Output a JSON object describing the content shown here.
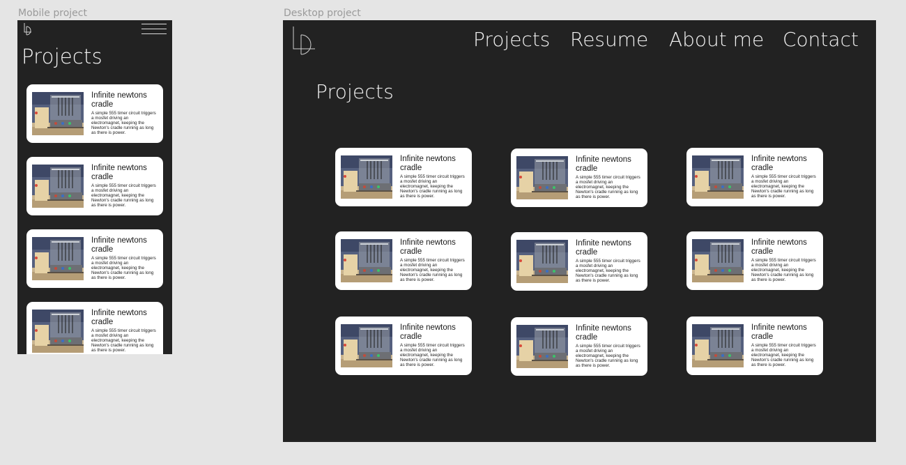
{
  "frames": {
    "mobile_label": "Mobile project",
    "desktop_label": "Desktop project"
  },
  "mobile": {
    "logo_icon": "ld-monogram-icon",
    "menu_icon": "hamburger-menu-icon",
    "page_title": "Projects",
    "cards": [
      {
        "title": "Infinite newtons cradle",
        "description": "A simple 555 timer circuit triggers a mosfet driving an electromagnet, keeping the Newton's cradle running as long as there is power."
      },
      {
        "title": "Infinite newtons cradle",
        "description": "A simple 555 timer circuit triggers a mosfet driving an electromagnet, keeping the Newton's cradle running as long as there is power."
      },
      {
        "title": "Infinite newtons cradle",
        "description": "A simple 555 timer circuit triggers a mosfet driving an electromagnet, keeping the Newton's cradle running as long as there is power."
      },
      {
        "title": "Infinite newtons cradle",
        "description": "A simple 555 timer circuit triggers a mosfet driving an electromagnet, keeping the Newton's cradle running as long as there is power."
      }
    ]
  },
  "desktop": {
    "logo_icon": "ld-monogram-icon",
    "nav": [
      "Projects",
      "Resume",
      "About me",
      "Contact"
    ],
    "page_title": "Projects",
    "cards": [
      {
        "title": "Infinite newtons cradle",
        "description": "A simple 555 timer circuit triggers a mosfet driving an electromagnet, keeping the Newton's cradle running as long as there is power."
      },
      {
        "title": "Infinite newtons cradle",
        "description": "A simple 555 timer circuit triggers a mosfet driving an electromagnet, keeping the Newton's cradle running as long as there is power."
      },
      {
        "title": "Infinite newtons cradle",
        "description": "A simple 555 timer circuit triggers a mosfet driving an electromagnet, keeping the Newton's cradle running as long as there is power."
      },
      {
        "title": "Infinite newtons cradle",
        "description": "A simple 555 timer circuit triggers a mosfet driving an electromagnet, keeping the Newton's cradle running as long as there is power."
      },
      {
        "title": "Infinite newtons cradle",
        "description": "A simple 555 timer circuit triggers a mosfet driving an electromagnet, keeping the Newton's cradle running as long as there is power."
      },
      {
        "title": "Infinite newtons cradle",
        "description": "A simple 555 timer circuit triggers a mosfet driving an electromagnet, keeping the Newton's cradle running as long as there is power."
      },
      {
        "title": "Infinite newtons cradle",
        "description": "A simple 555 timer circuit triggers a mosfet driving an electromagnet, keeping the Newton's cradle running as long as there is power."
      },
      {
        "title": "Infinite newtons cradle",
        "description": "A simple 555 timer circuit triggers a mosfet driving an electromagnet, keeping the Newton's cradle running as long as there is power."
      },
      {
        "title": "Infinite newtons cradle",
        "description": "A simple 555 timer circuit triggers a mosfet driving an electromagnet, keeping the Newton's cradle running as long as there is power."
      }
    ]
  },
  "colors": {
    "canvas": "#e5e5e5",
    "frame_background": "#222222",
    "card_background": "#ffffff",
    "text_light": "#f2f2f2",
    "text_dark": "#1a1a1a"
  }
}
